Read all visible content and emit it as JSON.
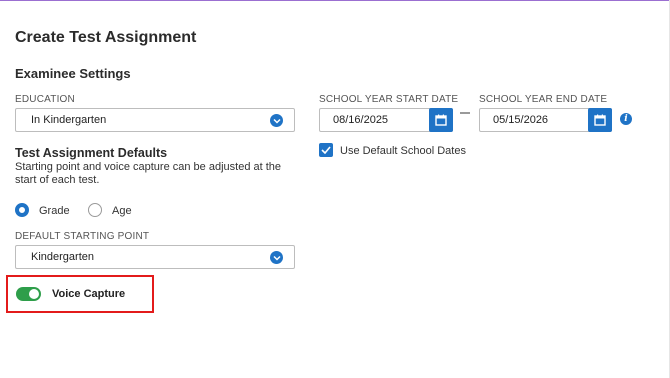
{
  "page": {
    "title": "Create Test Assignment"
  },
  "examinee": {
    "section_title": "Examinee Settings",
    "education": {
      "label": "EDUCATION",
      "value": "In Kindergarten"
    },
    "start_date": {
      "label": "SCHOOL YEAR START DATE",
      "value": "08/16/2025"
    },
    "end_date": {
      "label": "SCHOOL YEAR END DATE",
      "value": "05/15/2026"
    },
    "use_default_dates": {
      "label": "Use Default School Dates",
      "checked": true
    }
  },
  "defaults": {
    "title": "Test Assignment Defaults",
    "help": "Starting point and voice capture can be adjusted at the start of each test.",
    "radios": [
      {
        "label": "Grade",
        "selected": true
      },
      {
        "label": "Age",
        "selected": false
      }
    ],
    "starting_point": {
      "label": "DEFAULT STARTING POINT",
      "value": "Kindergarten"
    },
    "voice_capture": {
      "label": "Voice Capture",
      "on": true
    }
  },
  "colors": {
    "accent": "#1f73c6",
    "toggle_on": "#2e9e4a",
    "highlight": "#e31b1b"
  }
}
